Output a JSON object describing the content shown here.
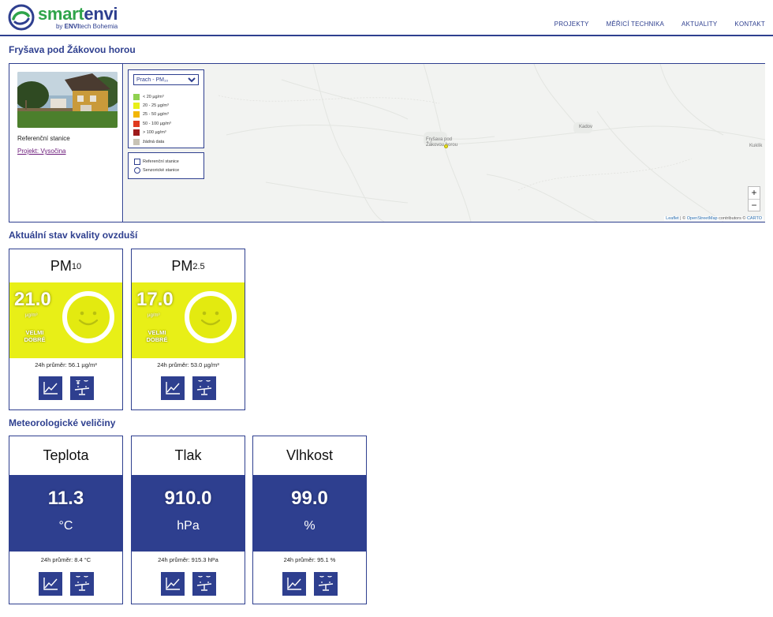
{
  "header": {
    "logo_part1": "smart",
    "logo_part2": "envi",
    "logo_sub_prefix": "by ",
    "logo_sub_brand": "ENVI",
    "logo_sub_suffix": "tech Bohemia",
    "nav": [
      "PROJEKTY",
      "MĚŘICÍ TECHNIKA",
      "AKTUALITY",
      "KONTAKT"
    ]
  },
  "station": {
    "title": "Fryšava pod Žákovou horou",
    "type": "Referenční stanice",
    "project_link": "Projekt: Vysočina"
  },
  "map": {
    "select_value": "Prach - PM₁₀",
    "legend": [
      {
        "label": "< 20 µg/m³",
        "color": "#8fd14f"
      },
      {
        "label": "20 - 25 µg/m³",
        "color": "#e8ef17"
      },
      {
        "label": "25 - 50 µg/m³",
        "color": "#f2b705"
      },
      {
        "label": "50 - 100 µg/m³",
        "color": "#e03a1e"
      },
      {
        "label": "> 100 µg/m³",
        "color": "#9e1a1a"
      },
      {
        "label": "žádná data",
        "color": "#c8c3b5"
      }
    ],
    "station_types": [
      "Referenční stanice",
      "Senzorické stanice"
    ],
    "marker_label_line1": "Fryšava pod",
    "marker_label_line2": "Žákovou horou",
    "town_kadov": "Kadov",
    "town_kuklik": "Kuklík",
    "zoom_in": "+",
    "zoom_out": "−",
    "attribution_leaflet": "Leaflet",
    "attribution_mid": " | © ",
    "attribution_osm": "OpenStreetMap",
    "attribution_contrib": " contributors © ",
    "attribution_carto": "CARTO"
  },
  "air_quality": {
    "section_title": "Aktuální stav kvality ovzduší",
    "cards": [
      {
        "name_main": "PM",
        "name_sub": "10",
        "value": "21.0",
        "unit": "µg/m³",
        "status_line1": "VELMI",
        "status_line2": "DOBRÉ",
        "avg": "24h průměr: 56.1 µg/m³",
        "color": "#e8ef17"
      },
      {
        "name_main": "PM",
        "name_sub": "2.5",
        "value": "17.0",
        "unit": "µg/m³",
        "status_line1": "VELMI",
        "status_line2": "DOBRÉ",
        "avg": "24h průměr: 53.0 µg/m³",
        "color": "#e8ef17"
      }
    ]
  },
  "meteo": {
    "section_title": "Meteorologické veličiny",
    "cards": [
      {
        "name": "Teplota",
        "value": "11.3",
        "unit": "°C",
        "avg": "24h průměr: 8.4 °C"
      },
      {
        "name": "Tlak",
        "value": "910.0",
        "unit": "hPa",
        "avg": "24h průměr: 915.3 hPa"
      },
      {
        "name": "Vlhkost",
        "value": "99.0",
        "unit": "%",
        "avg": "24h průměr: 95.1 %"
      }
    ]
  },
  "icons": {
    "chart": "line-chart-icon",
    "compare": "compare-stations-icon",
    "smiley": "smiley-face-icon"
  },
  "colors": {
    "brand_blue": "#2e3f8f",
    "brand_green": "#2fa44a",
    "good_yellow": "#e8ef17"
  }
}
